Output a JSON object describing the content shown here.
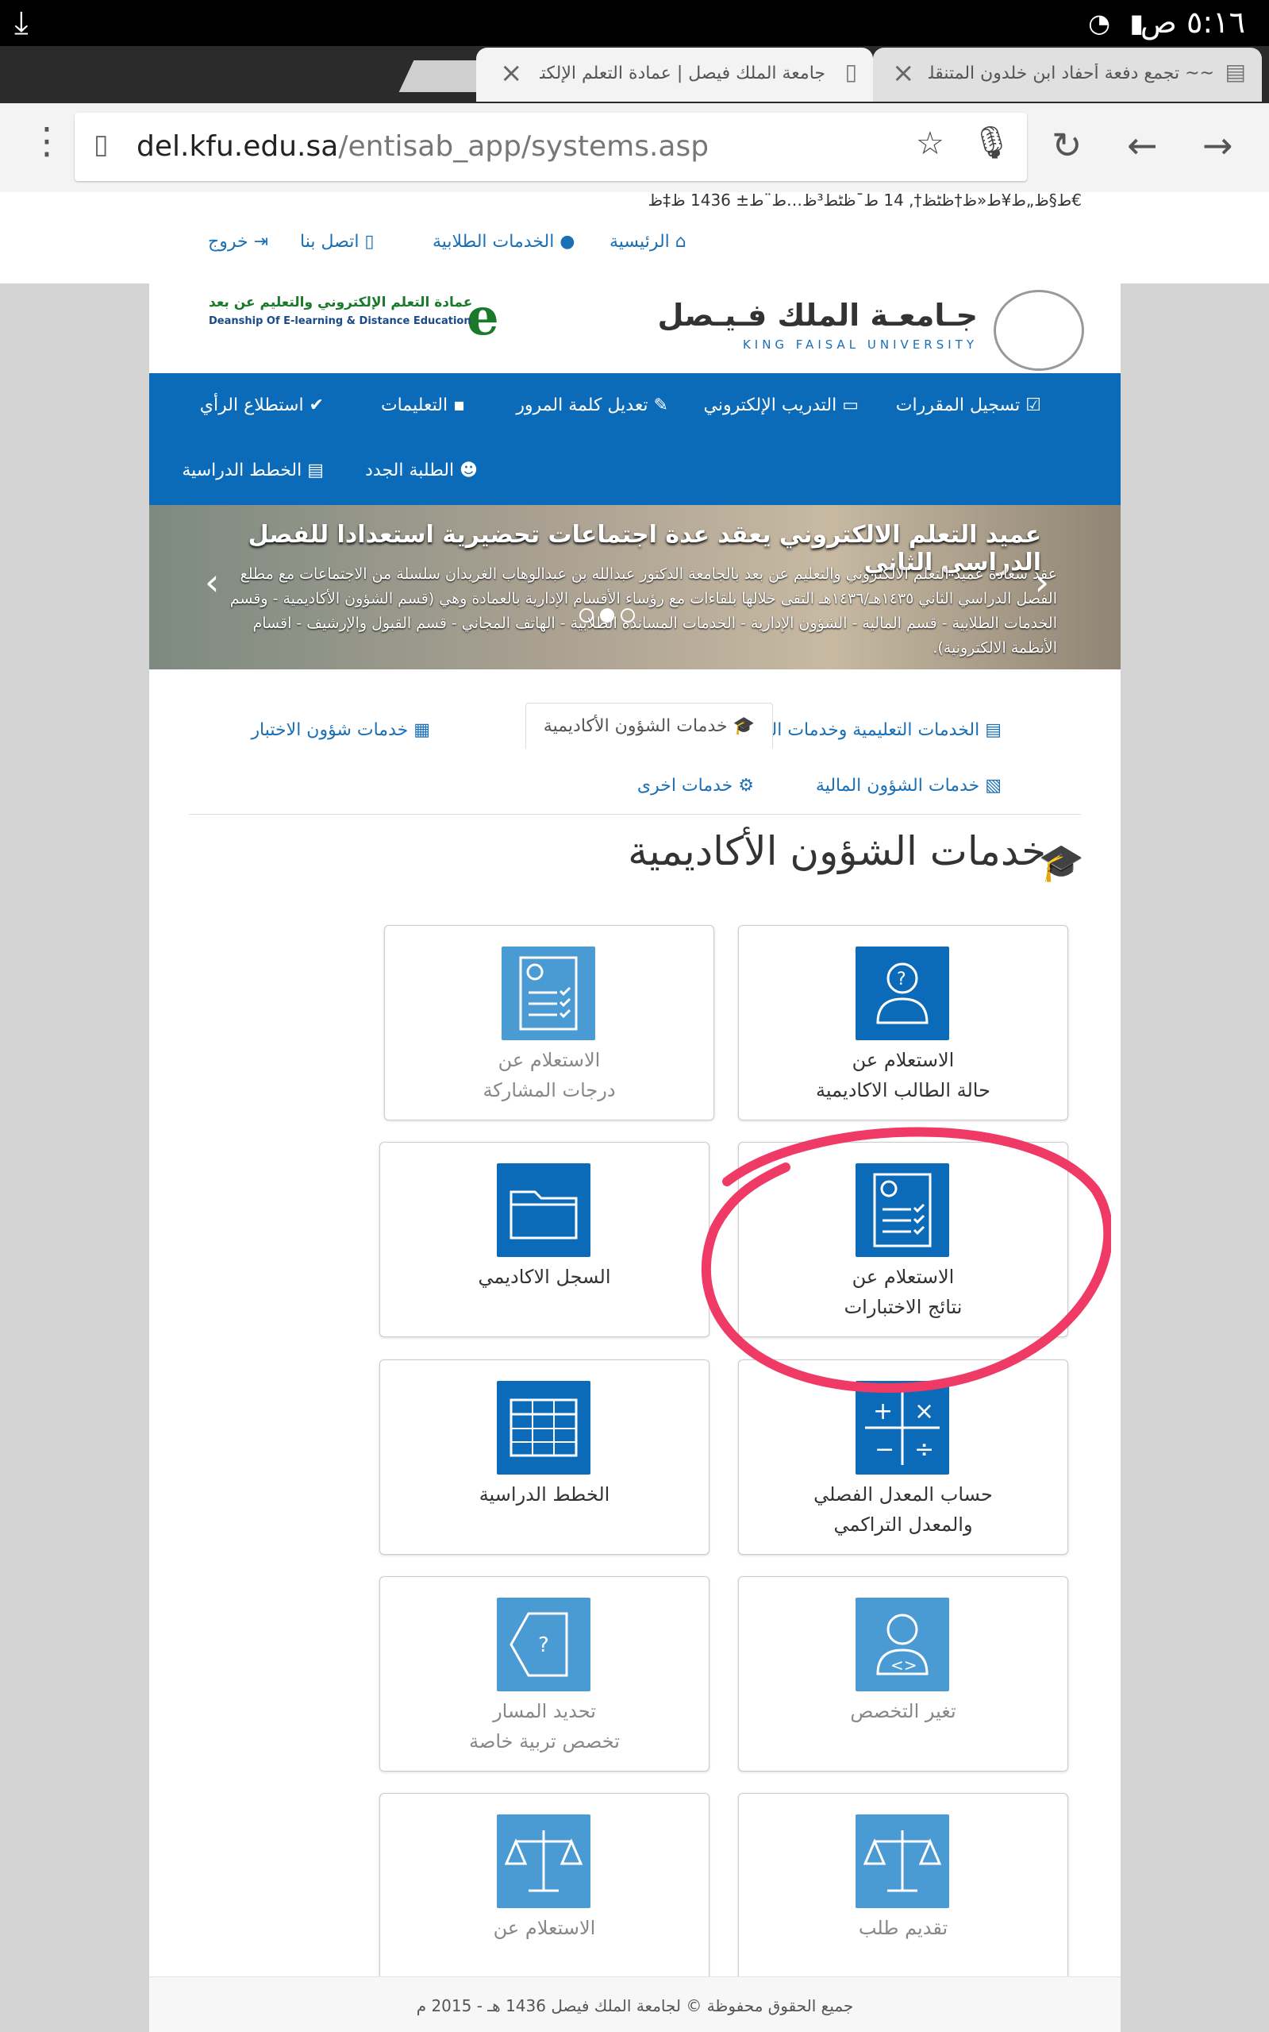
{
  "statusbar": {
    "time": "٥:١٦ ص"
  },
  "tabs": {
    "tab1_title": "جامعة الملك فيصل | عمادة التعلم الإلكتر",
    "tab2_title": "~~ تجمع دفعة أحفاد ابن خلدون المتنقله"
  },
  "omnibox": {
    "host": "del.kfu.edu.sa",
    "path": "/entisab_app/systems.asp"
  },
  "site": {
    "garbled_date": "ط§ظ„ط¥ط«ظ†ظٹظ†, 14 ط¯ظٹط³ظ…ط¨ط± 1436 ظ‡ظ€",
    "nav_home": "الرئيسية",
    "nav_student": "الخدمات الطلابية",
    "nav_contact": "اتصل بنا",
    "nav_logout": "خروج",
    "kfu_ar": "جـامعـة الملك فـيـصل",
    "kfu_en": "KING FAISAL UNIVERSITY",
    "del_ar": "عمادة التعلم الإلكتروني والتعليم عن بعد",
    "del_en": "Deanship Of E-learning & Distance Education",
    "e_logo": "e"
  },
  "bluenav": {
    "i1": "تسجيل المقررات",
    "i2": "التدريب الإلكتروني",
    "i3": "تعديل كلمة المرور",
    "i4": "التعليمات",
    "i5": "استطلاع الرأي",
    "i6": "الطلبة الجدد",
    "i7": "الخطط الدراسية"
  },
  "banner": {
    "title": "عميد التعلم الالكتروني يعقد عدة اجتماعات تحضيرية استعدادا للفصل الدراسي الثاني",
    "body": "عقد سعادة عميد التعلم الالكتروني والتعليم عن بعد بالجامعة الدكتور عبدالله بن عبدالوهاب الغريدان سلسلة من الاجتماعات مع مطلع الفصل الدراسي الثاني ١٤٣٥هـ/١٤٣٦هـ التقى خلالها بلقاءات مع رؤساء الأقسام الإدارية بالعمادة وهي (قسم الشؤون الأكاديمية - وقسم الخدمات الطلابية - قسم المالية - الشؤون الإدارية - الخدمات المساندة الطلابية - الهاتف المجاني - قسم القبول والإرشيف - اقسام الأنظمة الالكترونية)."
  },
  "service_tabs": {
    "t1": "الخدمات التعليمية وخدمات التعلم",
    "t2": "خدمات الشؤون الأكاديمية",
    "t3": "خدمات شؤون الاختبار",
    "t4": "خدمات الشؤون المالية",
    "t5": "خدمات اخرى"
  },
  "section_title": "خدمات الشؤون الأكاديمية",
  "cards": {
    "c1a": "الاستعلام عن",
    "c1b": "حالة الطالب الاكاديمية",
    "c2a": "الاستعلام عن",
    "c2b": "درجات المشاركة",
    "c3a": "الاستعلام عن",
    "c3b": "نتائج الاختبارات",
    "c4a": "السجل الاكاديمي",
    "c5a": "حساب المعدل الفصلي",
    "c5b": "والمعدل التراكمي",
    "c6a": "الخطط الدراسية",
    "c7a": "تغير التخصص",
    "c8a": "تحديد المسار",
    "c8b": "تخصص تربية خاصة",
    "c9a": "تقديم طلب",
    "c10a": "الاستعلام عن"
  },
  "footer": "جميع الحقوق محفوظة © لجامعة الملك فيصل 1436 هـ - 2015 م",
  "colors": {
    "primary": "#0c6bb8",
    "card_icon_dark": "#0c6bb8",
    "card_icon_light": "#4a9ad4",
    "highlight": "#ee3a64"
  }
}
